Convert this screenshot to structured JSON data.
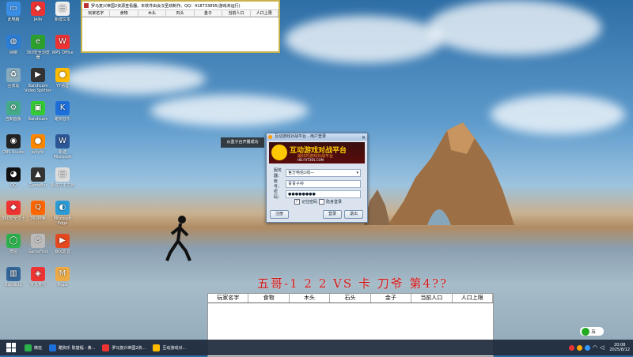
{
  "desktop_icons": [
    {
      "label": "此电脑",
      "color": "#3a8ee6",
      "glyph": "▭"
    },
    {
      "label": "Jello",
      "color": "#e33",
      "glyph": "◆"
    },
    {
      "label": "新建文本",
      "color": "#eee",
      "glyph": "▤"
    },
    {
      "label": "网络",
      "color": "#2b7cd3",
      "glyph": "◍"
    },
    {
      "label": "360安全浏览器",
      "color": "#2ca02c",
      "glyph": "e"
    },
    {
      "label": "WPS Office",
      "color": "#e33",
      "glyph": "W"
    },
    {
      "label": "回收站",
      "color": "#8ab",
      "glyph": "♻"
    },
    {
      "label": "Bandicam Video Splitter",
      "color": "#333",
      "glyph": "▶"
    },
    {
      "label": "YY语音",
      "color": "#fb0",
      "glyph": "●"
    },
    {
      "label": "控制面板",
      "color": "#4a8",
      "glyph": "⚙"
    },
    {
      "label": "Bandicam",
      "color": "#3c3",
      "glyph": "▣"
    },
    {
      "label": "酷狗音乐",
      "color": "#1e6fd9",
      "glyph": "K"
    },
    {
      "label": "OBS Studio",
      "color": "#222",
      "glyph": "◉"
    },
    {
      "label": "Jellyfin",
      "color": "#f80",
      "glyph": "●"
    },
    {
      "label": "新建 Microsoft Word",
      "color": "#2b5797",
      "glyph": "W"
    },
    {
      "label": "QQ",
      "color": "#111",
      "glyph": "◕"
    },
    {
      "label": "GameBar",
      "color": "#333",
      "glyph": "▲"
    },
    {
      "label": "新建文本文档",
      "color": "#ddd",
      "glyph": "▤"
    },
    {
      "label": "360安全卫士",
      "color": "#e33",
      "glyph": "◆"
    },
    {
      "label": "360搜索",
      "color": "#f60",
      "glyph": "Q"
    },
    {
      "label": "Microsoft Edge",
      "color": "#2a9bd6",
      "glyph": "◐"
    },
    {
      "label": "微信",
      "color": "#2bb24c",
      "glyph": "◯"
    },
    {
      "label": "GameFirst",
      "color": "#bbb",
      "glyph": "⚙"
    },
    {
      "label": "暴风影音",
      "color": "#e5481f",
      "glyph": "▶"
    },
    {
      "label": "Bandicut",
      "color": "#369",
      "glyph": "▥"
    },
    {
      "label": "罗马复兴",
      "color": "#e33",
      "glyph": "◈"
    },
    {
      "label": "Maps",
      "color": "#ea4",
      "glyph": "M"
    }
  ],
  "top_window": {
    "title": "罗马复兴帝国2资源查看器。本软件由会汉圣劲制作。QQ：418733895(游戏未运行)",
    "columns": [
      "玩家名字",
      "食物",
      "木头",
      "石头",
      "金子",
      "当前人口",
      "人口上限"
    ]
  },
  "toast": {
    "text": "从盒子台开播成功"
  },
  "login": {
    "title": "互动游戏对战平台 - 用户登录",
    "brand": "互动游戏对战平台",
    "sub1": "最好的游戏对战平台",
    "sub2": "HD.FXT365.COM",
    "server_label": "服务器：",
    "server_value": "官方电信1线—",
    "account_label": "帐 号：",
    "account_value": "青青子衿",
    "password_label": "密 码：",
    "password_value": "●●●●●●●●",
    "remember_label": "记住密码",
    "hidden_label": "隐身登录",
    "register_btn": "注册",
    "login_btn": "登录",
    "exit_btn": "退出"
  },
  "overlay_text": "五哥-1 2 2 VS 卡 刀爷 第4??",
  "bottom_window": {
    "columns": [
      "玩家名字",
      "食物",
      "木头",
      "石头",
      "金子",
      "当前人口",
      "人口上限"
    ]
  },
  "taskbar": {
    "items": [
      {
        "label": "微信",
        "color": "#2bb24c"
      },
      {
        "label": "酷狗乐 陈楚幅 - 黄...",
        "color": "#1e6fd9"
      },
      {
        "label": "罗马复兴帝国2资...",
        "color": "#e33"
      },
      {
        "label": "互动游戏对...",
        "color": "#fb0"
      }
    ],
    "ime": "五",
    "time": "20:08",
    "date": "2025/8/12"
  }
}
